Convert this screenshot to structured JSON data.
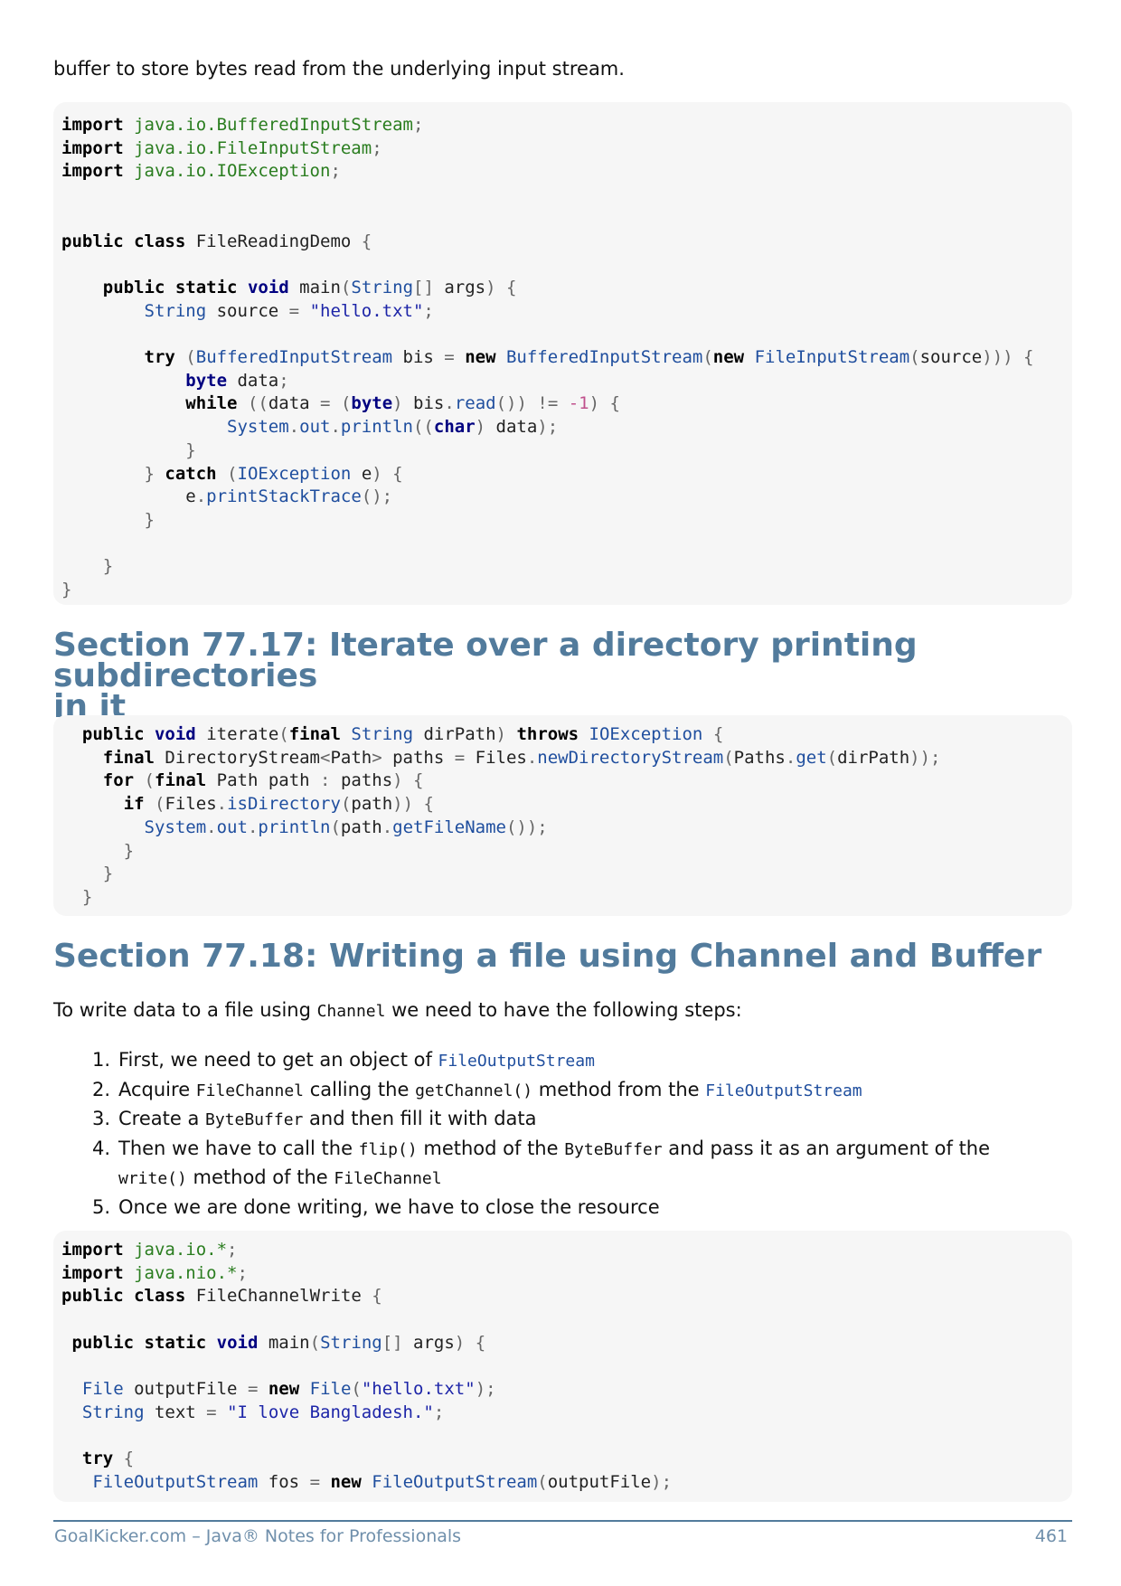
{
  "intro_text": "buffer to store bytes read from the underlying input stream.",
  "code_block_1": {
    "lines": [
      [
        [
          "kw",
          "import"
        ],
        [
          "pl",
          " "
        ],
        [
          "pk",
          "java.io.BufferedInputStream"
        ],
        [
          "pn",
          ";"
        ]
      ],
      [
        [
          "kw",
          "import"
        ],
        [
          "pl",
          " "
        ],
        [
          "pk",
          "java.io.FileInputStream"
        ],
        [
          "pn",
          ";"
        ]
      ],
      [
        [
          "kw",
          "import"
        ],
        [
          "pl",
          " "
        ],
        [
          "pk",
          "java.io.IOException"
        ],
        [
          "pn",
          ";"
        ]
      ],
      [],
      [],
      [
        [
          "kw",
          "public"
        ],
        [
          "pl",
          " "
        ],
        [
          "kw",
          "class"
        ],
        [
          "pl",
          " FileReadingDemo "
        ],
        [
          "pn",
          "{"
        ]
      ],
      [],
      [
        [
          "pl",
          "    "
        ],
        [
          "kw",
          "public"
        ],
        [
          "pl",
          " "
        ],
        [
          "kw",
          "static"
        ],
        [
          "pl",
          " "
        ],
        [
          "kwb",
          "void"
        ],
        [
          "pl",
          " main"
        ],
        [
          "pn",
          "("
        ],
        [
          "ty",
          "String"
        ],
        [
          "pn",
          "[]"
        ],
        [
          "pl",
          " args"
        ],
        [
          "pn",
          ")"
        ],
        [
          "pl",
          " "
        ],
        [
          "pn",
          "{"
        ]
      ],
      [
        [
          "pl",
          "        "
        ],
        [
          "ty",
          "String"
        ],
        [
          "pl",
          " source "
        ],
        [
          "pn",
          "="
        ],
        [
          "pl",
          " "
        ],
        [
          "st",
          "\"hello.txt\""
        ],
        [
          "pn",
          ";"
        ]
      ],
      [],
      [
        [
          "pl",
          "        "
        ],
        [
          "kw",
          "try"
        ],
        [
          "pl",
          " "
        ],
        [
          "pn",
          "("
        ],
        [
          "ty",
          "BufferedInputStream"
        ],
        [
          "pl",
          " bis "
        ],
        [
          "pn",
          "="
        ],
        [
          "pl",
          " "
        ],
        [
          "kw",
          "new"
        ],
        [
          "pl",
          " "
        ],
        [
          "ty",
          "BufferedInputStream"
        ],
        [
          "pn",
          "("
        ],
        [
          "kw",
          "new"
        ],
        [
          "pl",
          " "
        ],
        [
          "ty",
          "FileInputStream"
        ],
        [
          "pn",
          "("
        ],
        [
          "pl",
          "source"
        ],
        [
          "pn",
          ")))"
        ],
        [
          "pl",
          " "
        ],
        [
          "pn",
          "{"
        ]
      ],
      [
        [
          "pl",
          "            "
        ],
        [
          "kwb",
          "byte"
        ],
        [
          "pl",
          " data"
        ],
        [
          "pn",
          ";"
        ]
      ],
      [
        [
          "pl",
          "            "
        ],
        [
          "kw",
          "while"
        ],
        [
          "pl",
          " "
        ],
        [
          "pn",
          "(("
        ],
        [
          "pl",
          "data "
        ],
        [
          "pn",
          "="
        ],
        [
          "pl",
          " "
        ],
        [
          "pn",
          "("
        ],
        [
          "kwb",
          "byte"
        ],
        [
          "pn",
          ")"
        ],
        [
          "pl",
          " bis"
        ],
        [
          "pn",
          "."
        ],
        [
          "fn",
          "read"
        ],
        [
          "pn",
          "())"
        ],
        [
          "pl",
          " "
        ],
        [
          "pn",
          "!="
        ],
        [
          "pl",
          " "
        ],
        [
          "nm",
          "-1"
        ],
        [
          "pn",
          ")"
        ],
        [
          "pl",
          " "
        ],
        [
          "pn",
          "{"
        ]
      ],
      [
        [
          "pl",
          "                "
        ],
        [
          "ty",
          "System"
        ],
        [
          "pn",
          "."
        ],
        [
          "fn",
          "out"
        ],
        [
          "pn",
          "."
        ],
        [
          "fn",
          "println"
        ],
        [
          "pn",
          "(("
        ],
        [
          "kwb",
          "char"
        ],
        [
          "pn",
          ")"
        ],
        [
          "pl",
          " data"
        ],
        [
          "pn",
          ");"
        ]
      ],
      [
        [
          "pl",
          "            "
        ],
        [
          "pn",
          "}"
        ]
      ],
      [
        [
          "pl",
          "        "
        ],
        [
          "pn",
          "}"
        ],
        [
          "pl",
          " "
        ],
        [
          "kw",
          "catch"
        ],
        [
          "pl",
          " "
        ],
        [
          "pn",
          "("
        ],
        [
          "ty",
          "IOException"
        ],
        [
          "pl",
          " e"
        ],
        [
          "pn",
          ")"
        ],
        [
          "pl",
          " "
        ],
        [
          "pn",
          "{"
        ]
      ],
      [
        [
          "pl",
          "            e"
        ],
        [
          "pn",
          "."
        ],
        [
          "fn",
          "printStackTrace"
        ],
        [
          "pn",
          "();"
        ]
      ],
      [
        [
          "pl",
          "        "
        ],
        [
          "pn",
          "}"
        ]
      ],
      [],
      [
        [
          "pl",
          "    "
        ],
        [
          "pn",
          "}"
        ]
      ],
      [
        [
          "pn",
          "}"
        ]
      ]
    ]
  },
  "section_77_17": {
    "title_line1": "Section 77.17: Iterate over a directory printing subdirectories",
    "title_line2": "in it"
  },
  "code_block_2": {
    "lines": [
      [
        [
          "pl",
          "  "
        ],
        [
          "kw",
          "public"
        ],
        [
          "pl",
          " "
        ],
        [
          "kwb",
          "void"
        ],
        [
          "pl",
          " iterate"
        ],
        [
          "pn",
          "("
        ],
        [
          "kw",
          "final"
        ],
        [
          "pl",
          " "
        ],
        [
          "ty",
          "String"
        ],
        [
          "pl",
          " dirPath"
        ],
        [
          "pn",
          ")"
        ],
        [
          "pl",
          " "
        ],
        [
          "kw",
          "throws"
        ],
        [
          "pl",
          " "
        ],
        [
          "ty",
          "IOException"
        ],
        [
          "pl",
          " "
        ],
        [
          "pn",
          "{"
        ]
      ],
      [
        [
          "pl",
          "    "
        ],
        [
          "kw",
          "final"
        ],
        [
          "pl",
          " DirectoryStream"
        ],
        [
          "pn",
          "<"
        ],
        [
          "pl",
          "Path"
        ],
        [
          "pn",
          ">"
        ],
        [
          "pl",
          " paths "
        ],
        [
          "pn",
          "="
        ],
        [
          "pl",
          " Files"
        ],
        [
          "pn",
          "."
        ],
        [
          "fn",
          "newDirectoryStream"
        ],
        [
          "pn",
          "("
        ],
        [
          "pl",
          "Paths"
        ],
        [
          "pn",
          "."
        ],
        [
          "fn",
          "get"
        ],
        [
          "pn",
          "("
        ],
        [
          "pl",
          "dirPath"
        ],
        [
          "pn",
          "));"
        ]
      ],
      [
        [
          "pl",
          "    "
        ],
        [
          "kw",
          "for"
        ],
        [
          "pl",
          " "
        ],
        [
          "pn",
          "("
        ],
        [
          "kw",
          "final"
        ],
        [
          "pl",
          " Path path "
        ],
        [
          "pn",
          ":"
        ],
        [
          "pl",
          " paths"
        ],
        [
          "pn",
          ")"
        ],
        [
          "pl",
          " "
        ],
        [
          "pn",
          "{"
        ]
      ],
      [
        [
          "pl",
          "      "
        ],
        [
          "kw",
          "if"
        ],
        [
          "pl",
          " "
        ],
        [
          "pn",
          "("
        ],
        [
          "pl",
          "Files"
        ],
        [
          "pn",
          "."
        ],
        [
          "fn",
          "isDirectory"
        ],
        [
          "pn",
          "("
        ],
        [
          "pl",
          "path"
        ],
        [
          "pn",
          "))"
        ],
        [
          "pl",
          " "
        ],
        [
          "pn",
          "{"
        ]
      ],
      [
        [
          "pl",
          "        "
        ],
        [
          "ty",
          "System"
        ],
        [
          "pn",
          "."
        ],
        [
          "fn",
          "out"
        ],
        [
          "pn",
          "."
        ],
        [
          "fn",
          "println"
        ],
        [
          "pn",
          "("
        ],
        [
          "pl",
          "path"
        ],
        [
          "pn",
          "."
        ],
        [
          "fn",
          "getFileName"
        ],
        [
          "pn",
          "());"
        ]
      ],
      [
        [
          "pl",
          "      "
        ],
        [
          "pn",
          "}"
        ]
      ],
      [
        [
          "pl",
          "    "
        ],
        [
          "pn",
          "}"
        ]
      ],
      [
        [
          "pl",
          "  "
        ],
        [
          "pn",
          "}"
        ]
      ]
    ]
  },
  "section_77_18": {
    "title": "Section 77.18: Writing a file using Channel and Buffer",
    "intro_before": "To write data to a file using ",
    "intro_code": "Channel",
    "intro_after": " we need to have the following steps:",
    "steps": [
      {
        "num": "1.",
        "parts": [
          [
            "t",
            "First, we need to get an object of "
          ],
          [
            "cb",
            "FileOutputStream"
          ]
        ]
      },
      {
        "num": "2.",
        "parts": [
          [
            "t",
            "Acquire "
          ],
          [
            "c",
            "FileChannel"
          ],
          [
            "t",
            " calling the "
          ],
          [
            "c",
            "getChannel()"
          ],
          [
            "t",
            " method from the "
          ],
          [
            "cb",
            "FileOutputStream"
          ]
        ]
      },
      {
        "num": "3.",
        "parts": [
          [
            "t",
            "Create a "
          ],
          [
            "c",
            "ByteBuffer"
          ],
          [
            "t",
            " and then fill it with data"
          ]
        ]
      },
      {
        "num": "4.",
        "parts": [
          [
            "t",
            "Then we have to call the "
          ],
          [
            "c",
            "flip()"
          ],
          [
            "t",
            " method of the "
          ],
          [
            "c",
            "ByteBuffer"
          ],
          [
            "t",
            " and pass it as an argument of the "
          ],
          [
            "c",
            "write()"
          ],
          [
            "t",
            " method of the "
          ],
          [
            "c",
            "FileChannel"
          ]
        ]
      },
      {
        "num": "5.",
        "parts": [
          [
            "t",
            "Once we are done writing, we have to close the resource"
          ]
        ]
      }
    ]
  },
  "code_block_3": {
    "lines": [
      [
        [
          "kw",
          "import"
        ],
        [
          "pl",
          " "
        ],
        [
          "pk",
          "java.io.*"
        ],
        [
          "pn",
          ";"
        ]
      ],
      [
        [
          "kw",
          "import"
        ],
        [
          "pl",
          " "
        ],
        [
          "pk",
          "java.nio.*"
        ],
        [
          "pn",
          ";"
        ]
      ],
      [
        [
          "kw",
          "public"
        ],
        [
          "pl",
          " "
        ],
        [
          "kw",
          "class"
        ],
        [
          "pl",
          " FileChannelWrite "
        ],
        [
          "pn",
          "{"
        ]
      ],
      [],
      [
        [
          "pl",
          " "
        ],
        [
          "kw",
          "public"
        ],
        [
          "pl",
          " "
        ],
        [
          "kw",
          "static"
        ],
        [
          "pl",
          " "
        ],
        [
          "kwb",
          "void"
        ],
        [
          "pl",
          " main"
        ],
        [
          "pn",
          "("
        ],
        [
          "ty",
          "String"
        ],
        [
          "pn",
          "[]"
        ],
        [
          "pl",
          " args"
        ],
        [
          "pn",
          ")"
        ],
        [
          "pl",
          " "
        ],
        [
          "pn",
          "{"
        ]
      ],
      [],
      [
        [
          "pl",
          "  "
        ],
        [
          "ty",
          "File"
        ],
        [
          "pl",
          " outputFile "
        ],
        [
          "pn",
          "="
        ],
        [
          "pl",
          " "
        ],
        [
          "kw",
          "new"
        ],
        [
          "pl",
          " "
        ],
        [
          "ty",
          "File"
        ],
        [
          "pn",
          "("
        ],
        [
          "st",
          "\"hello.txt\""
        ],
        [
          "pn",
          ");"
        ]
      ],
      [
        [
          "pl",
          "  "
        ],
        [
          "ty",
          "String"
        ],
        [
          "pl",
          " text "
        ],
        [
          "pn",
          "="
        ],
        [
          "pl",
          " "
        ],
        [
          "st",
          "\"I love Bangladesh.\""
        ],
        [
          "pn",
          ";"
        ]
      ],
      [],
      [
        [
          "pl",
          "  "
        ],
        [
          "kw",
          "try"
        ],
        [
          "pl",
          " "
        ],
        [
          "pn",
          "{"
        ]
      ],
      [
        [
          "pl",
          "   "
        ],
        [
          "ty",
          "FileOutputStream"
        ],
        [
          "pl",
          " fos "
        ],
        [
          "pn",
          "="
        ],
        [
          "pl",
          " "
        ],
        [
          "kw",
          "new"
        ],
        [
          "pl",
          " "
        ],
        [
          "ty",
          "FileOutputStream"
        ],
        [
          "pn",
          "("
        ],
        [
          "pl",
          "outputFile"
        ],
        [
          "pn",
          ");"
        ]
      ]
    ]
  },
  "footer": {
    "left": "GoalKicker.com – Java® Notes for Professionals",
    "right": "461"
  },
  "colors": {
    "heading": "#527b9c",
    "code_bg": "#f6f6f6",
    "keyword": "#000000",
    "type": "#1f4e9e",
    "package": "#2a7d1f",
    "string": "#1d25a8",
    "number": "#c0508c"
  }
}
